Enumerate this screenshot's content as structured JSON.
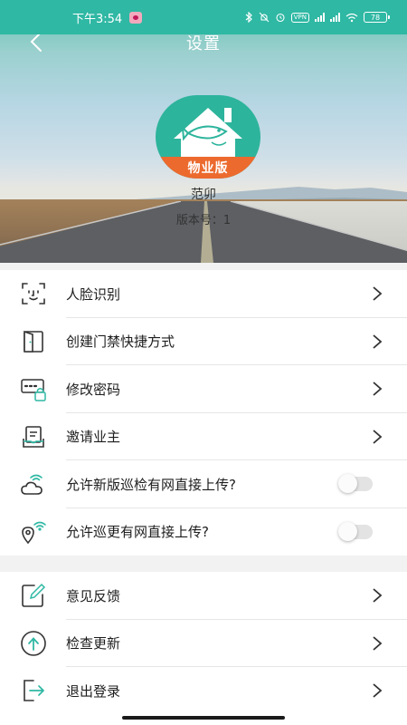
{
  "status_bar": {
    "time": "下午3:54",
    "vpn_label": "VPN",
    "battery": "78"
  },
  "header": {
    "title": "设置",
    "logo_text": "物业版",
    "username": "范卯",
    "version": "版本号：1"
  },
  "menu_group_1": [
    {
      "label": "人脸识别",
      "icon": "face-scan-icon",
      "control": "chevron"
    },
    {
      "label": "创建门禁快捷方式",
      "icon": "door-icon",
      "control": "chevron"
    },
    {
      "label": "修改密码",
      "icon": "password-lock-icon",
      "control": "chevron"
    },
    {
      "label": "邀请业主",
      "icon": "invite-icon",
      "control": "chevron"
    },
    {
      "label": "允许新版巡检有网直接上传?",
      "icon": "cloud-wifi-icon",
      "control": "toggle",
      "enabled": false
    },
    {
      "label": "允许巡更有网直接上传?",
      "icon": "location-wifi-icon",
      "control": "toggle",
      "enabled": false
    }
  ],
  "menu_group_2": [
    {
      "label": "意见反馈",
      "icon": "feedback-edit-icon",
      "control": "chevron"
    },
    {
      "label": "检查更新",
      "icon": "upload-arrow-icon",
      "control": "chevron"
    },
    {
      "label": "退出登录",
      "icon": "logout-icon",
      "control": "chevron"
    }
  ],
  "colors": {
    "accent": "#2fb8a4",
    "icon": "#333333",
    "logo_band": "#ec6a2e"
  }
}
